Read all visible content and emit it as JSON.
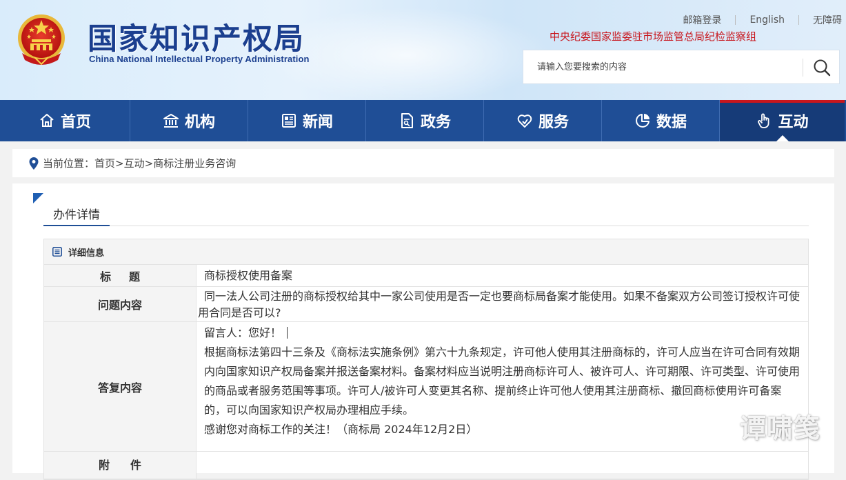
{
  "header": {
    "site_title": "国家知识产权局",
    "site_subtitle": "China National Intellectual Property Administration",
    "top_links": [
      "邮箱登录",
      "English",
      "无障碍"
    ],
    "inspection_text": "中央纪委国家监委驻市场监管总局纪检监察组",
    "search_placeholder": "请输入您要搜索的内容"
  },
  "nav": {
    "items": [
      {
        "label": "首页",
        "icon": "home-icon"
      },
      {
        "label": "机构",
        "icon": "institution-icon"
      },
      {
        "label": "新闻",
        "icon": "news-icon"
      },
      {
        "label": "政务",
        "icon": "document-icon"
      },
      {
        "label": "服务",
        "icon": "heart-hand-icon"
      },
      {
        "label": "数据",
        "icon": "pie-chart-icon"
      },
      {
        "label": "互动",
        "icon": "hand-pointer-icon"
      }
    ],
    "active": "互动"
  },
  "breadcrumb": {
    "prefix": "当前位置：",
    "items": [
      "首页",
      "互动",
      "商标注册业务咨询"
    ],
    "separator": ">"
  },
  "section_tab": "办件详情",
  "detail": {
    "header": "详细信息",
    "title_label": "标题",
    "title_value": "商标授权使用备案",
    "question_label": "问题内容",
    "question_value": "同一法人公司注册的商标授权给其中一家公司使用是否一定也要商标局备案才能使用。如果不备案双方公司签订授权许可使用合同是否可以?",
    "answer_label": "答复内容",
    "answer_greeting": "留言人：您好！",
    "answer_body": "根据商标法第四十三条及《商标法实施条例》第六十九条规定，许可他人使用其注册商标的，许可人应当在许可合同有效期内向国家知识产权局备案并报送备案材料。备案材料应当说明注册商标许可人、被许可人、许可期限、许可类型、许可使用的商品或者服务范围等事项。许可人/被许可人变更其名称、提前终止许可他人使用其注册商标、撤回商标使用许可备案的，可以向国家知识产权局办理相应手续。",
    "answer_thanks": "感谢您对商标工作的关注！（商标局 2024年12月2日）",
    "attachment_label": "附件"
  },
  "watermark": "谭啸笺",
  "colors": {
    "nav_bg": "#1f4e96",
    "nav_active": "#163b78",
    "title_blue": "#1b3f8f",
    "alert_red": "#c8161d"
  }
}
